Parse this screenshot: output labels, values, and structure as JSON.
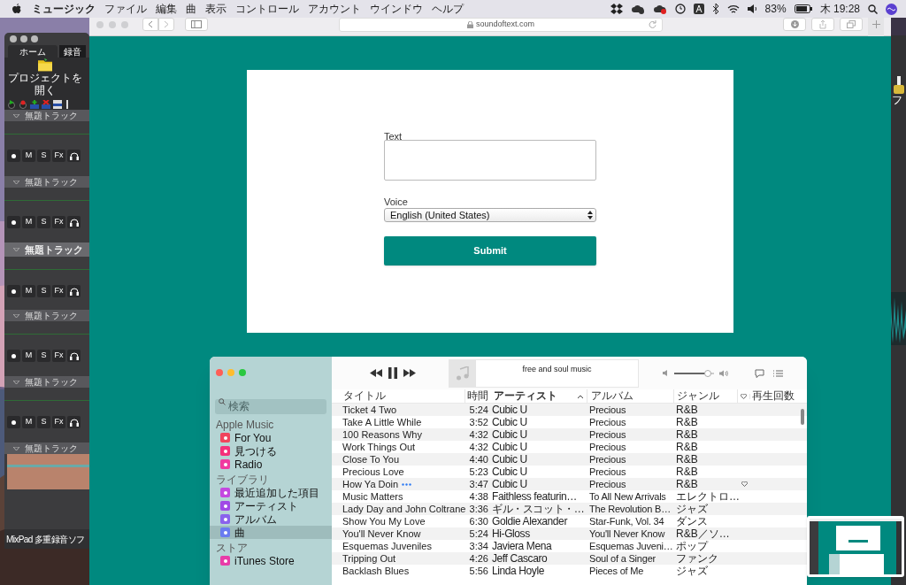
{
  "menu_bar": {
    "app": "ミュージック",
    "menus": [
      "ファイル",
      "編集",
      "曲",
      "表示",
      "コントロール",
      "アカウント",
      "ウインドウ",
      "ヘルプ"
    ],
    "battery": "83%",
    "clock": "木 19:28"
  },
  "mixpad": {
    "tabs": [
      {
        "label": "ホーム",
        "selected": true
      },
      {
        "label": "録音",
        "selected": false
      }
    ],
    "open_button": "プロジェクトを開く",
    "tracks": [
      {
        "name": "無題トラック",
        "selected": false,
        "kind": "empty",
        "buttons": [
          "M",
          "S",
          "Fx"
        ]
      },
      {
        "name": "無題トラック",
        "selected": false,
        "kind": "empty",
        "buttons": [
          "M",
          "S",
          "Fx"
        ]
      },
      {
        "name": "無題トラック",
        "selected": true,
        "kind": "empty",
        "buttons": [
          "M",
          "S",
          "Fx"
        ]
      },
      {
        "name": "無題トラック",
        "selected": false,
        "kind": "empty",
        "buttons": [
          "M",
          "S",
          "Fx"
        ]
      },
      {
        "name": "無題トラック",
        "selected": false,
        "kind": "empty",
        "buttons": [
          "M",
          "S",
          "Fx"
        ]
      },
      {
        "name": "無題トラック",
        "selected": false,
        "kind": "clip"
      }
    ],
    "status": "MixPad 多重録音ソフ"
  },
  "right_app": {
    "label": "フ"
  },
  "safari": {
    "address": "soundoftext.com",
    "form": {
      "text_label": "Text",
      "voice_label": "Voice",
      "voice_value": "English (United States)",
      "submit": "Submit"
    }
  },
  "music": {
    "search": {
      "placeholder": "検索"
    },
    "sections": [
      {
        "title": "Apple Music",
        "items": [
          {
            "label": "For You",
            "color": "#f0445c",
            "selected": false
          },
          {
            "label": "見つける",
            "color": "#f4307a",
            "selected": false
          },
          {
            "label": "Radio",
            "color": "#f03aa0",
            "selected": false
          }
        ]
      },
      {
        "title": "ライブラリ",
        "items": [
          {
            "label": "最近追加した項目",
            "color": "#c448e0",
            "selected": false
          },
          {
            "label": "アーティスト",
            "color": "#a04ae6",
            "selected": false
          },
          {
            "label": "アルバム",
            "color": "#8a62ec",
            "selected": false
          },
          {
            "label": "曲",
            "color": "#6a7cf0",
            "selected": true
          }
        ]
      },
      {
        "title": "ストア",
        "items": [
          {
            "label": "iTunes Store",
            "color": "#e83ca8",
            "selected": false
          }
        ]
      }
    ],
    "now_playing": "free and soul music",
    "volume": {
      "level": 0.85
    },
    "columns": [
      "タイトル",
      "時間",
      "アーティスト",
      "アルバム",
      "ジャンル",
      "再生回数"
    ],
    "rows": [
      {
        "title": "Ticket 4 Two",
        "time": "5:24",
        "artist": "Cubic U",
        "album": "Precious",
        "genre": "R&B",
        "hovered": false
      },
      {
        "title": "Take A Little While",
        "time": "3:52",
        "artist": "Cubic U",
        "album": "Precious",
        "genre": "R&B",
        "hovered": false
      },
      {
        "title": "100 Reasons Why",
        "time": "4:32",
        "artist": "Cubic U",
        "album": "Precious",
        "genre": "R&B",
        "hovered": false
      },
      {
        "title": "Work Things Out",
        "time": "4:32",
        "artist": "Cubic U",
        "album": "Precious",
        "genre": "R&B",
        "hovered": false
      },
      {
        "title": "Close To You",
        "time": "4:40",
        "artist": "Cubic U",
        "album": "Precious",
        "genre": "R&B",
        "hovered": false
      },
      {
        "title": "Precious Love",
        "time": "5:23",
        "artist": "Cubic U",
        "album": "Precious",
        "genre": "R&B",
        "hovered": false
      },
      {
        "title": "How Ya Doin",
        "time": "3:47",
        "artist": "Cubic U",
        "album": "Precious",
        "genre": "R&B",
        "hovered": true
      },
      {
        "title": "Music Matters",
        "time": "4:38",
        "artist": "Faithless featurin…",
        "album": "To All New Arrivals",
        "genre": "エレクトロ…",
        "hovered": false
      },
      {
        "title": "Lady Day and John Coltrane",
        "time": "3:36",
        "artist": "ギル・スコット・…",
        "album": "The Revolution B…",
        "genre": "ジャズ",
        "hovered": false
      },
      {
        "title": "Show You My Love",
        "time": "6:30",
        "artist": "Goldie Alexander",
        "album": "Star-Funk, Vol. 34",
        "genre": "ダンス",
        "hovered": false
      },
      {
        "title": "You'll Never Know",
        "time": "5:24",
        "artist": "Hi-Gloss",
        "album": "You'll Never Know",
        "genre": "R&B／ソ…",
        "hovered": false
      },
      {
        "title": "Esquemas Juveniles",
        "time": "3:34",
        "artist": "Javiera Mena",
        "album": "Esquemas Juveni…",
        "genre": "ポップ",
        "hovered": false
      },
      {
        "title": "Tripping Out",
        "time": "4:26",
        "artist": "Jeff Cascaro",
        "album": "Soul of a Singer",
        "genre": "ファンク",
        "hovered": false
      },
      {
        "title": "Backlash Blues",
        "time": "5:56",
        "artist": "Linda Hoyle",
        "album": "Pieces of Me",
        "genre": "ジャズ",
        "hovered": false
      }
    ]
  }
}
